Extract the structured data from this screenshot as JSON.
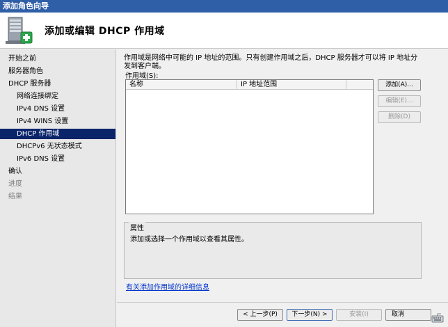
{
  "window": {
    "title": "添加角色向导"
  },
  "header": {
    "title": "添加或编辑 DHCP 作用域"
  },
  "sidebar": {
    "items": [
      {
        "label": "开始之前",
        "state": "normal",
        "level": 0
      },
      {
        "label": "服务器角色",
        "state": "normal",
        "level": 0
      },
      {
        "label": "DHCP 服务器",
        "state": "normal",
        "level": 0
      },
      {
        "label": "网络连接绑定",
        "state": "normal",
        "level": 1
      },
      {
        "label": "IPv4 DNS 设置",
        "state": "normal",
        "level": 1
      },
      {
        "label": "IPv4 WINS 设置",
        "state": "normal",
        "level": 1
      },
      {
        "label": "DHCP 作用域",
        "state": "active",
        "level": 1
      },
      {
        "label": "DHCPv6 无状态模式",
        "state": "normal",
        "level": 1
      },
      {
        "label": "IPv6 DNS 设置",
        "state": "normal",
        "level": 1
      },
      {
        "label": "确认",
        "state": "normal",
        "level": 0
      },
      {
        "label": "进度",
        "state": "disabled",
        "level": 0
      },
      {
        "label": "结果",
        "state": "disabled",
        "level": 0
      }
    ]
  },
  "main": {
    "description": "作用域是网络中可能的 IP 地址的范围。只有创建作用域之后，DHCP 服务器才可以将 IP 地址分发到客户端。",
    "scopes_label": "作用域(S):",
    "columns": [
      "名称",
      "IP 地址范围",
      ""
    ],
    "rows": [],
    "buttons": {
      "add": "添加(A)...",
      "edit": "编辑(E)...",
      "delete": "删除(D)"
    },
    "properties": {
      "title": "属性",
      "text": "添加或选择一个作用域以查看其属性。"
    },
    "link": "有关添加作用域的详细信息"
  },
  "footer": {
    "prev": "< 上一步(P)",
    "next": "下一步(N) >",
    "install": "安装(I)",
    "cancel": "取消"
  },
  "icons": {
    "header": "server-add-icon",
    "tray": "keyboard-icon"
  },
  "colors": {
    "titlebar": "#2f5fa7",
    "selection": "#0a246a",
    "link": "#0033cc"
  }
}
